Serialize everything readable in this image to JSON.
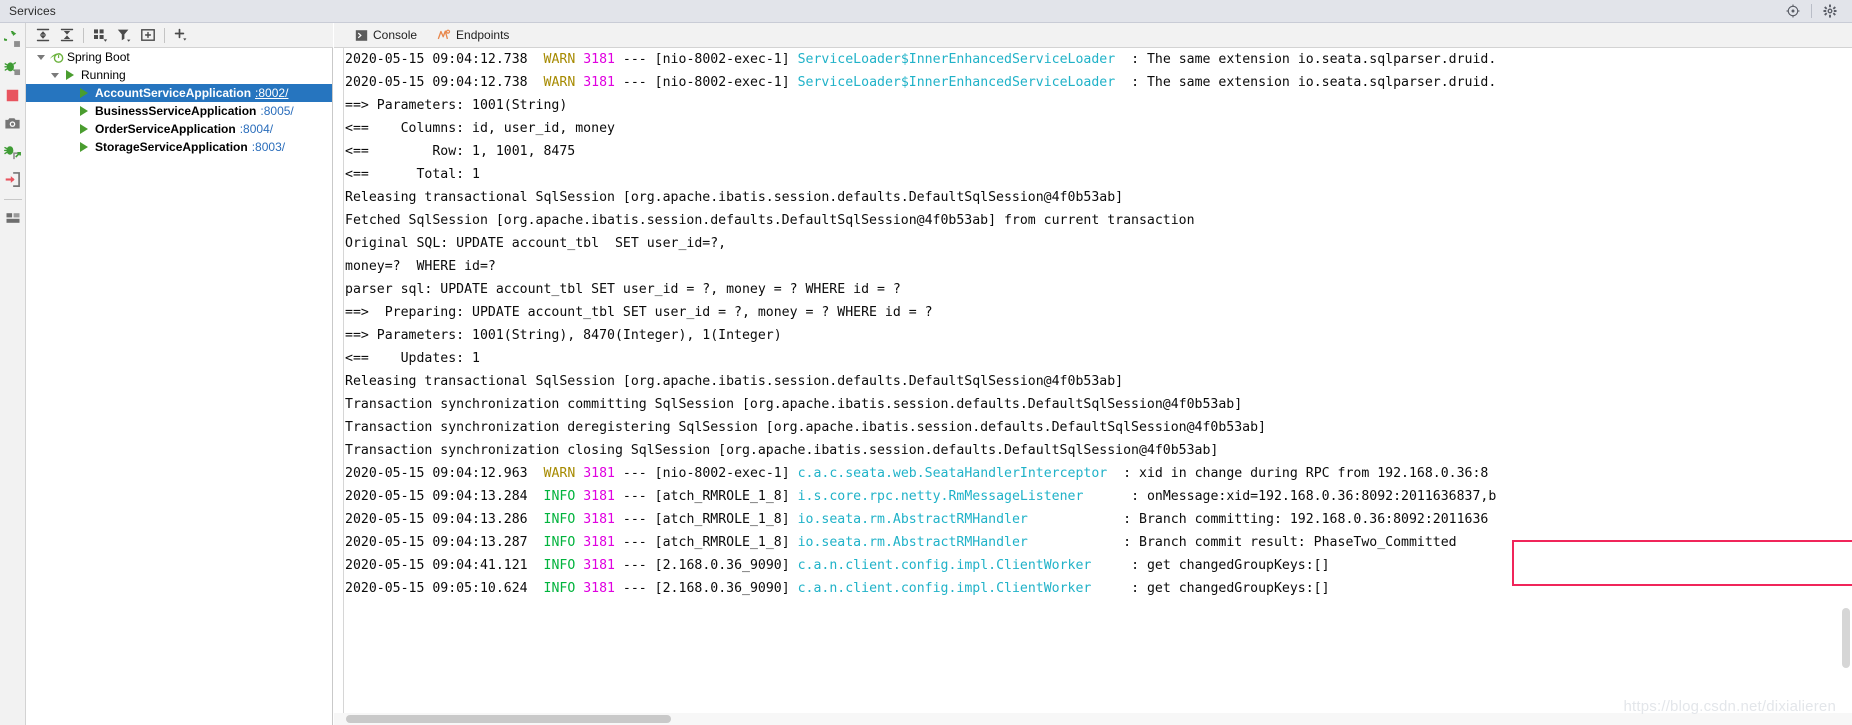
{
  "window": {
    "title": "Services",
    "right_icons": [
      "target-icon",
      "gear-icon"
    ]
  },
  "left_strip": {
    "icons": [
      "rerun-icon",
      "debug-icon",
      "stop-icon",
      "camera-icon",
      "attach-debugger-icon",
      "exit-icon",
      "layout-icon"
    ]
  },
  "services_toolbar": {
    "icons": [
      "expand-all-icon",
      "collapse-all-icon",
      "group-by-icon",
      "filter-icon",
      "show-in-new-window-icon",
      "add-icon"
    ]
  },
  "services_tree": {
    "nodes": [
      {
        "label": "Spring Boot",
        "port": "",
        "level": 0,
        "icon": "spring-boot-icon",
        "twisty": "down",
        "selected": false,
        "bold": false
      },
      {
        "label": "Running",
        "port": "",
        "level": 1,
        "icon": "run-icon",
        "twisty": "down",
        "selected": false,
        "bold": false
      },
      {
        "label": "AccountServiceApplication",
        "port": ":8002/",
        "level": 2,
        "icon": "run-icon",
        "twisty": "none",
        "selected": true,
        "bold": true
      },
      {
        "label": "BusinessServiceApplication",
        "port": ":8005/",
        "level": 2,
        "icon": "run-icon",
        "twisty": "none",
        "selected": false,
        "bold": true
      },
      {
        "label": "OrderServiceApplication",
        "port": ":8004/",
        "level": 2,
        "icon": "run-icon",
        "twisty": "none",
        "selected": false,
        "bold": true
      },
      {
        "label": "StorageServiceApplication",
        "port": ":8003/",
        "level": 2,
        "icon": "run-icon",
        "twisty": "none",
        "selected": false,
        "bold": true
      }
    ]
  },
  "console": {
    "tabs": [
      {
        "label": "Console",
        "icon": "console-icon",
        "active": true
      },
      {
        "label": "Endpoints",
        "icon": "endpoints-icon",
        "active": false
      }
    ],
    "log_lines": [
      [
        {
          "t": "2020-05-15 09:04:12.738  ",
          "c": "plain"
        },
        {
          "t": "WARN",
          "c": "warn"
        },
        {
          "t": " ",
          "c": "plain"
        },
        {
          "t": "3181",
          "c": "pid"
        },
        {
          "t": " --- [nio-8002-exec-1] ",
          "c": "plain"
        },
        {
          "t": "ServiceLoader$InnerEnhancedServiceLoader",
          "c": "class"
        },
        {
          "t": "  : The same extension io.seata.sqlparser.druid.",
          "c": "plain"
        }
      ],
      [
        {
          "t": "2020-05-15 09:04:12.738  ",
          "c": "plain"
        },
        {
          "t": "WARN",
          "c": "warn"
        },
        {
          "t": " ",
          "c": "plain"
        },
        {
          "t": "3181",
          "c": "pid"
        },
        {
          "t": " --- [nio-8002-exec-1] ",
          "c": "plain"
        },
        {
          "t": "ServiceLoader$InnerEnhancedServiceLoader",
          "c": "class"
        },
        {
          "t": "  : The same extension io.seata.sqlparser.druid.",
          "c": "plain"
        }
      ],
      [
        {
          "t": "==> Parameters: 1001(String)",
          "c": "plain"
        }
      ],
      [
        {
          "t": "<==    Columns: id, user_id, money",
          "c": "plain"
        }
      ],
      [
        {
          "t": "<==        Row: 1, 1001, 8475",
          "c": "plain"
        }
      ],
      [
        {
          "t": "<==      Total: 1",
          "c": "plain"
        }
      ],
      [
        {
          "t": "Releasing transactional SqlSession [org.apache.ibatis.session.defaults.DefaultSqlSession@4f0b53ab]",
          "c": "plain"
        }
      ],
      [
        {
          "t": "Fetched SqlSession [org.apache.ibatis.session.defaults.DefaultSqlSession@4f0b53ab] from current transaction",
          "c": "plain"
        }
      ],
      [
        {
          "t": "Original SQL: UPDATE account_tbl  SET user_id=?,",
          "c": "plain"
        }
      ],
      [
        {
          "t": "money=?  WHERE id=?",
          "c": "plain"
        }
      ],
      [
        {
          "t": "parser sql: UPDATE account_tbl SET user_id = ?, money = ? WHERE id = ?",
          "c": "plain"
        }
      ],
      [
        {
          "t": "==>  Preparing: UPDATE account_tbl SET user_id = ?, money = ? WHERE id = ?",
          "c": "plain"
        }
      ],
      [
        {
          "t": "==> Parameters: 1001(String), 8470(Integer), 1(Integer)",
          "c": "plain"
        }
      ],
      [
        {
          "t": "<==    Updates: 1",
          "c": "plain"
        }
      ],
      [
        {
          "t": "Releasing transactional SqlSession [org.apache.ibatis.session.defaults.DefaultSqlSession@4f0b53ab]",
          "c": "plain"
        }
      ],
      [
        {
          "t": "Transaction synchronization committing SqlSession [org.apache.ibatis.session.defaults.DefaultSqlSession@4f0b53ab]",
          "c": "plain"
        }
      ],
      [
        {
          "t": "Transaction synchronization deregistering SqlSession [org.apache.ibatis.session.defaults.DefaultSqlSession@4f0b53ab]",
          "c": "plain"
        }
      ],
      [
        {
          "t": "Transaction synchronization closing SqlSession [org.apache.ibatis.session.defaults.DefaultSqlSession@4f0b53ab]",
          "c": "plain"
        }
      ],
      [
        {
          "t": "2020-05-15 09:04:12.963  ",
          "c": "plain"
        },
        {
          "t": "WARN",
          "c": "warn"
        },
        {
          "t": " ",
          "c": "plain"
        },
        {
          "t": "3181",
          "c": "pid"
        },
        {
          "t": " --- [nio-8002-exec-1] ",
          "c": "plain"
        },
        {
          "t": "c.a.c.seata.web.SeataHandlerInterceptor",
          "c": "class"
        },
        {
          "t": "  : xid in change during RPC from 192.168.0.36:8",
          "c": "plain"
        }
      ],
      [
        {
          "t": "2020-05-15 09:04:13.284  ",
          "c": "plain"
        },
        {
          "t": "INFO",
          "c": "info"
        },
        {
          "t": " ",
          "c": "plain"
        },
        {
          "t": "3181",
          "c": "pid"
        },
        {
          "t": " --- [atch_RMROLE_1_8] ",
          "c": "plain"
        },
        {
          "t": "i.s.core.rpc.netty.RmMessageListener",
          "c": "class"
        },
        {
          "t": "      : onMessage:xid=192.168.0.36:8092:2011636837,b",
          "c": "plain"
        }
      ],
      [
        {
          "t": "2020-05-15 09:04:13.286  ",
          "c": "plain"
        },
        {
          "t": "INFO",
          "c": "info"
        },
        {
          "t": " ",
          "c": "plain"
        },
        {
          "t": "3181",
          "c": "pid"
        },
        {
          "t": " --- [atch_RMROLE_1_8] ",
          "c": "plain"
        },
        {
          "t": "io.seata.rm.AbstractRMHandler",
          "c": "class"
        },
        {
          "t": "            : Branch committing: 192.168.0.36:8092:2011636",
          "c": "plain"
        }
      ],
      [
        {
          "t": "2020-05-15 09:04:13.287  ",
          "c": "plain"
        },
        {
          "t": "INFO",
          "c": "info"
        },
        {
          "t": " ",
          "c": "plain"
        },
        {
          "t": "3181",
          "c": "pid"
        },
        {
          "t": " --- [atch_RMROLE_1_8] ",
          "c": "plain"
        },
        {
          "t": "io.seata.rm.AbstractRMHandler",
          "c": "class"
        },
        {
          "t": "            : Branch commit result: PhaseTwo_Committed",
          "c": "plain"
        }
      ],
      [
        {
          "t": "2020-05-15 09:04:41.121  ",
          "c": "plain"
        },
        {
          "t": "INFO",
          "c": "info"
        },
        {
          "t": " ",
          "c": "plain"
        },
        {
          "t": "3181",
          "c": "pid"
        },
        {
          "t": " --- [2.168.0.36_9090] ",
          "c": "plain"
        },
        {
          "t": "c.a.n.client.config.impl.ClientWorker",
          "c": "class"
        },
        {
          "t": "     : get changedGroupKeys:[]",
          "c": "plain"
        }
      ],
      [
        {
          "t": "2020-05-15 09:05:10.624  ",
          "c": "plain"
        },
        {
          "t": "INFO",
          "c": "info"
        },
        {
          "t": " ",
          "c": "plain"
        },
        {
          "t": "3181",
          "c": "pid"
        },
        {
          "t": " --- [2.168.0.36_9090] ",
          "c": "plain"
        },
        {
          "t": "c.a.n.client.config.impl.ClientWorker",
          "c": "class"
        },
        {
          "t": "     : get changedGroupKeys:[]",
          "c": "plain"
        }
      ]
    ],
    "annotation": {
      "type": "red-highlight-box",
      "color": "#f0255a",
      "lines": [
        ": Branch committing: 192.168.0.36:8092:2011636",
        ": Branch commit result: PhaseTwo_Committed"
      ]
    }
  },
  "watermark": {
    "text": "https://blog.csdn.net/dixialieren"
  },
  "colors": {
    "selection": "#2675bf",
    "warn": "#a68a00",
    "info": "#00b33c",
    "pid": "#e000e0",
    "class": "#20b2c8",
    "annotation": "#f0255a",
    "titlebar_bg": "#e2e4ea",
    "toolbar_bg": "#f2f2f2"
  }
}
